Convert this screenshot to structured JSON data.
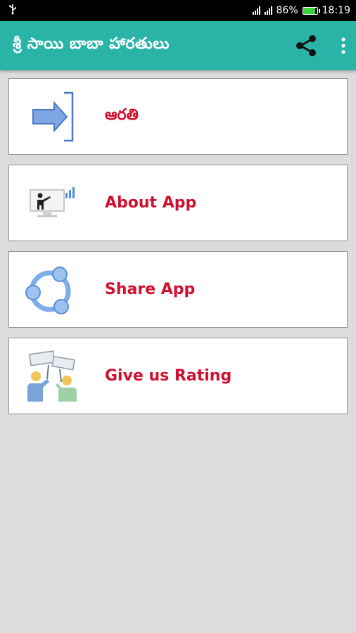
{
  "status_bar": {
    "usb_icon": "usb-icon",
    "battery_percent": "86%",
    "battery_level": 0.86,
    "time": "18:19"
  },
  "app_bar": {
    "title": "శ్రీ సాయి బాబా హారతులు",
    "background": "#2ab3a7",
    "actions": [
      "share-icon",
      "overflow-menu-icon"
    ]
  },
  "menu": {
    "label_color": "#d0102f",
    "items": [
      {
        "label": "ఆరతి",
        "icon": "enter-arrow-icon"
      },
      {
        "label": "About App",
        "icon": "presentation-icon"
      },
      {
        "label": "Share App",
        "icon": "share-circle-icon"
      },
      {
        "label": "Give us Rating",
        "icon": "rating-people-icon"
      }
    ]
  }
}
